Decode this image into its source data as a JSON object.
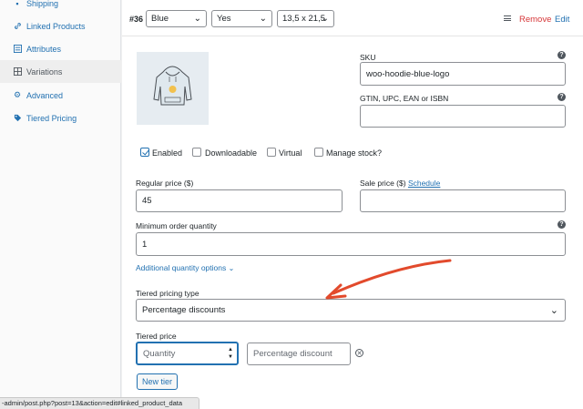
{
  "sidebar": {
    "items": [
      {
        "label": "Shipping",
        "icon": "truck-icon"
      },
      {
        "label": "Linked Products",
        "icon": "link-icon"
      },
      {
        "label": "Attributes",
        "icon": "list-icon"
      },
      {
        "label": "Variations",
        "icon": "grid-icon",
        "active": true
      },
      {
        "label": "Advanced",
        "icon": "gear-icon"
      },
      {
        "label": "Tiered Pricing",
        "icon": "tag-icon"
      }
    ]
  },
  "variation": {
    "number": "#36",
    "attr_color": "Blue",
    "attr_logo": "Yes",
    "attr_size": "13,5 x 21,5",
    "remove_label": "Remove",
    "edit_label": "Edit"
  },
  "fields": {
    "sku_label": "SKU",
    "sku_value": "woo-hoodie-blue-logo",
    "gtin_label": "GTIN, UPC, EAN or ISBN",
    "gtin_value": "",
    "enabled_label": "Enabled",
    "downloadable_label": "Downloadable",
    "virtual_label": "Virtual",
    "manage_stock_label": "Manage stock?",
    "regular_price_label": "Regular price ($)",
    "regular_price_value": "45",
    "sale_price_label": "Sale price ($)",
    "schedule_label": "Schedule",
    "sale_price_value": "",
    "min_qty_label": "Minimum order quantity",
    "min_qty_value": "1",
    "additional_qty_label": "Additional quantity options",
    "tiered_type_label": "Tiered pricing type",
    "tiered_type_value": "Percentage discounts",
    "tiered_price_label": "Tiered price",
    "quantity_placeholder": "Quantity",
    "percentage_placeholder": "Percentage discount",
    "new_tier_label": "New tier"
  },
  "checkboxes": {
    "enabled": true,
    "downloadable": false,
    "virtual": false,
    "manage_stock": false
  },
  "colors": {
    "accent": "#2271b1",
    "danger": "#d63638",
    "annotation_arrow": "#e24a2c"
  },
  "status_bar": {
    "url": "-admin/post.php?post=13&action=edit#linked_product_data"
  }
}
